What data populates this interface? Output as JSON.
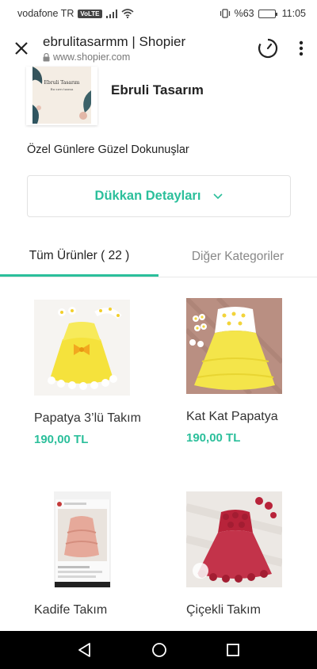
{
  "status_bar": {
    "carrier": "vodafone TR",
    "volte": "VoLTE",
    "battery": "%63",
    "time": "11:05",
    "battery_level": 0.63
  },
  "browser": {
    "title": "ebrulitasarmm | Shopier",
    "url": "www.shopier.com"
  },
  "shop": {
    "logo_text_line1": "Ebruli Tasarım",
    "logo_text_line2": "Bu sırrı tasma",
    "name": "Ebruli Tasarım",
    "slogan": "Özel Günlere Güzel Dokunuşlar",
    "details_label": "Dükkan Detayları"
  },
  "tabs": [
    {
      "label": "Tüm Ürünler ( 22 )",
      "active": true
    },
    {
      "label": "Diğer Kategoriler",
      "active": false
    }
  ],
  "products": [
    {
      "name": "Papatya 3’lü Takım",
      "price": "190,00 TL"
    },
    {
      "name": "Kat Kat Papatya",
      "price": "190,00 TL"
    },
    {
      "name": "Kadife Takım",
      "price": ""
    },
    {
      "name": "Çiçekli Takım",
      "price": ""
    }
  ],
  "colors": {
    "accent": "#2bbf9b",
    "text": "#222222",
    "muted": "#888888"
  }
}
